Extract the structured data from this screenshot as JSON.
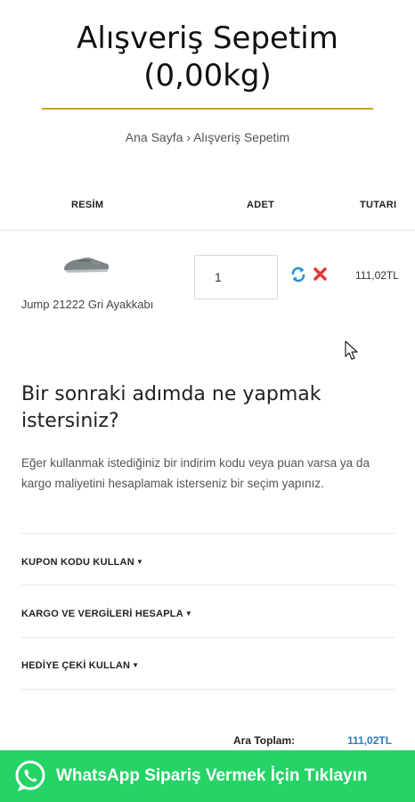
{
  "header": {
    "title_line1": "Alışveriş Sepetim",
    "title_line2": "(0,00kg)"
  },
  "breadcrumb": {
    "home": "Ana Sayfa",
    "separator": "›",
    "current": "Alışveriş Sepetim"
  },
  "table": {
    "columns": [
      "RESİM",
      "ADET",
      "TUTARI"
    ],
    "rows": [
      {
        "product_name": "Jump 21222 Gri Ayakkabı",
        "quantity": "1",
        "total": "111,02TL"
      }
    ]
  },
  "next_step": {
    "title": "Bir sonraki adımda ne yapmak istersiniz?",
    "description": "Eğer kullanmak istediğiniz bir indirim kodu veya puan varsa ya da kargo maliyetini hesaplamak isterseniz bir seçim yapınız.",
    "options": [
      "KUPON KODU KULLAN",
      "KARGO VE VERGİLERİ HESAPLA",
      "HEDİYE ÇEKİ KULLAN"
    ]
  },
  "totals": {
    "subtotal_label": "Ara Toplam:",
    "subtotal_value": "111,02TL"
  },
  "whatsapp": {
    "label": "WhatsApp Sipariş Vermek İçin Tıklayın"
  },
  "icons": {
    "update": "refresh-icon",
    "remove": "remove-icon",
    "whatsapp": "whatsapp-icon",
    "caret": "caret-down-icon"
  },
  "colors": {
    "accent_gold": "#c9a227",
    "update_blue": "#2f8fd6",
    "remove_red": "#e53935",
    "price_blue": "#2f7bbf",
    "whatsapp_green": "#25d366"
  }
}
